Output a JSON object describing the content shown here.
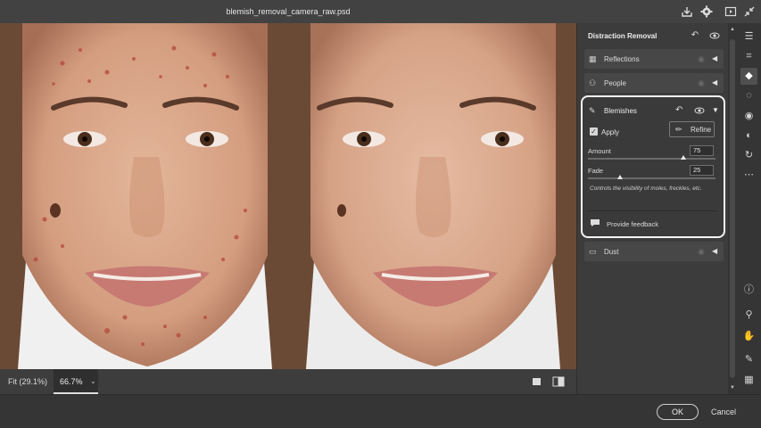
{
  "window": {
    "title": "blemish_removal_camera_raw.psd"
  },
  "titlebar_icons": [
    "save-icon",
    "gear-icon",
    "fullscreen-icon",
    "collapse-icon"
  ],
  "panel": {
    "title": "Distraction Removal",
    "rows": {
      "reflections": {
        "label": "Reflections"
      },
      "people": {
        "label": "People"
      },
      "dust": {
        "label": "Dust"
      }
    },
    "blemishes": {
      "label": "Blemishes",
      "apply_label": "Apply",
      "apply_checked": true,
      "refine_label": "Refine",
      "amount": {
        "label": "Amount",
        "value": "75",
        "fraction": 0.75
      },
      "fade": {
        "label": "Fade",
        "value": "25",
        "fraction": 0.25
      },
      "description": "Controls the visibility of moles, freckles, etc.",
      "feedback_label": "Provide feedback"
    }
  },
  "zoombar": {
    "fit_label": "Fit (29.1%)",
    "zoom_value": "66.7%"
  },
  "footer": {
    "ok_label": "OK",
    "cancel_label": "Cancel"
  },
  "tools": [
    "edit-icon",
    "crop-icon",
    "eraser-icon",
    "mask-icon",
    "red-eye-icon",
    "presets-icon",
    "convert-icon",
    "more-icon",
    "info-icon",
    "zoom-icon",
    "hand-icon",
    "eyedropper-icon",
    "grid-icon"
  ],
  "colors": {
    "accent_outline": "#f4f4f4",
    "panel_bg": "#3c3c3c",
    "rail_bg": "#353535"
  }
}
